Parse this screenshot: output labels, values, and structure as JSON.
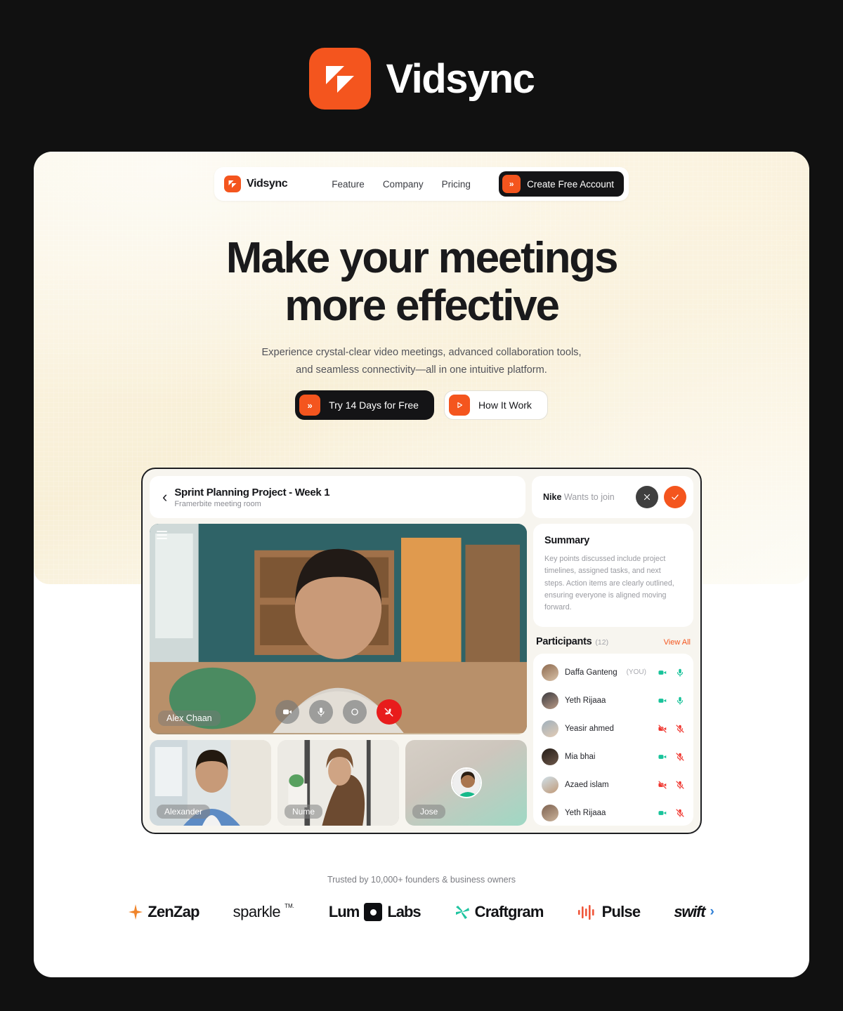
{
  "brand": {
    "name": "Vidsync",
    "logo_icon": "vidsync-sail-logo",
    "accent_color": "#F4551E",
    "dark_color": "#141416"
  },
  "nav": {
    "logo_text": "Vidsync",
    "links": [
      {
        "label": "Feature"
      },
      {
        "label": "Company"
      },
      {
        "label": "Pricing"
      }
    ],
    "cta": {
      "label": "Create Free Account",
      "icon": "double-chevron-right-icon"
    }
  },
  "hero": {
    "headline_line1": "Make your meetings",
    "headline_line2": "more effective",
    "subhead_line1": "Experience crystal-clear video meetings, advanced collaboration tools,",
    "subhead_line2": "and seamless connectivity—all in one intuitive platform.",
    "primary_cta": {
      "label": "Try 14 Days for Free",
      "icon": "double-chevron-right-icon"
    },
    "secondary_cta": {
      "label": "How It Work",
      "icon": "play-icon"
    }
  },
  "app": {
    "meeting": {
      "title": "Sprint Planning Project - Week 1",
      "subtitle": "Framerbite meeting room",
      "back_icon": "chevron-left-icon",
      "menu_icon": "hamburger-menu-icon"
    },
    "join_request": {
      "person": "Nike",
      "message": "Wants to join",
      "decline_icon": "close-icon",
      "accept_icon": "check-icon"
    },
    "main_speaker": {
      "name": "Alex Chaan"
    },
    "controls": [
      {
        "name": "camera-toggle",
        "icon": "video-camera-icon",
        "state": "on"
      },
      {
        "name": "microphone-toggle",
        "icon": "microphone-icon",
        "state": "on"
      },
      {
        "name": "record-button",
        "icon": "record-circle-icon",
        "state": "off"
      },
      {
        "name": "end-call-button",
        "icon": "phone-hangup-icon",
        "state": "danger"
      }
    ],
    "thumbnails": [
      {
        "name": "Alexander"
      },
      {
        "name": "Nume"
      },
      {
        "name": "Jose"
      }
    ],
    "summary": {
      "title": "Summary",
      "body": "Key points discussed include project timelines, assigned tasks, and next steps. Action items are clearly outlined, ensuring everyone is aligned moving forward."
    },
    "participants": {
      "title": "Participants",
      "count": "(12)",
      "view_all": "View All",
      "list": [
        {
          "name": "Daffa Ganteng",
          "tag": "(YOU)",
          "camera": "on",
          "mic": "on"
        },
        {
          "name": "Yeth Rijaaa",
          "tag": "",
          "camera": "on",
          "mic": "on"
        },
        {
          "name": "Yeasir ahmed",
          "tag": "",
          "camera": "off",
          "mic": "off"
        },
        {
          "name": "Mia bhai",
          "tag": "",
          "camera": "on",
          "mic": "off"
        },
        {
          "name": "Azaed islam",
          "tag": "",
          "camera": "off",
          "mic": "off"
        },
        {
          "name": "Yeth Rijaaa",
          "tag": "",
          "camera": "on",
          "mic": "off"
        }
      ],
      "on_color": "#18C39A",
      "off_color": "#F0322B"
    }
  },
  "trusted": {
    "caption": "Trusted by 10,000+ founders & business owners",
    "logos": [
      {
        "name": "ZenZap",
        "icon": "spark-icon"
      },
      {
        "name": "sparkle",
        "icon": "none",
        "superscript": "TM."
      },
      {
        "name": "Lum",
        "name2": "Labs",
        "icon": "square-dot-icon"
      },
      {
        "name": "Craftgram",
        "icon": "pinwheel-icon"
      },
      {
        "name": "Pulse",
        "icon": "waveform-icon"
      },
      {
        "name": "swift",
        "icon": "chevron-right-icon"
      }
    ]
  }
}
